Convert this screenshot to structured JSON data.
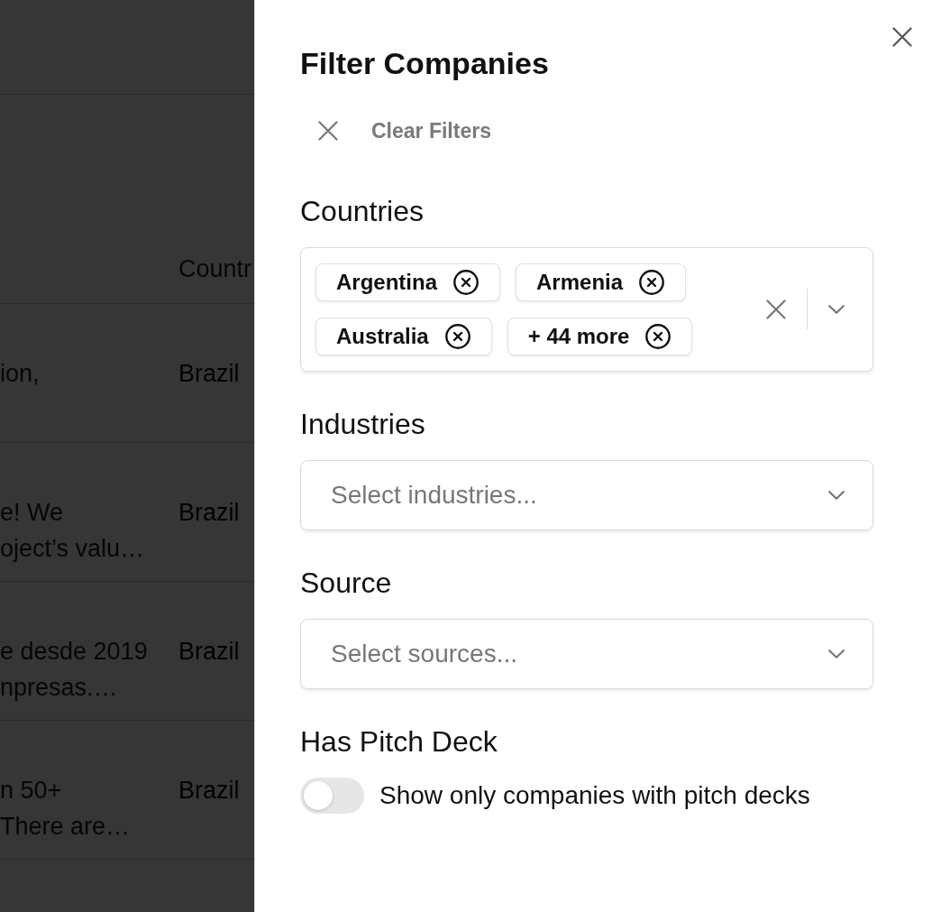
{
  "background_table": {
    "column_2_header": "Countr",
    "rows": [
      {
        "column_1": [
          "ion,"
        ],
        "column_2": "Brazil"
      },
      {
        "column_1": [
          "e! We",
          "oject’s valu…"
        ],
        "column_2": "Brazil"
      },
      {
        "column_1": [
          "e desde 2019",
          "npresas.…"
        ],
        "column_2": "Brazil"
      },
      {
        "column_1": [
          "n 50+",
          "There are…"
        ],
        "column_2": "Brazil"
      }
    ]
  },
  "panel": {
    "title": "Filter Companies",
    "clear_button": "Clear Filters"
  },
  "filters": [
    {
      "kind": "multiselect",
      "label": "Countries",
      "tags": [
        {
          "label": "Argentina"
        },
        {
          "label": "Armenia"
        },
        {
          "label": "Australia"
        },
        {
          "label": "+ 44 more"
        }
      ]
    },
    {
      "kind": "select",
      "label": "Industries",
      "placeholder": "Select industries..."
    },
    {
      "kind": "select",
      "label": "Source",
      "placeholder": "Select sources..."
    },
    {
      "kind": "toggle",
      "label": "Has Pitch Deck",
      "text": "Show only companies with pitch decks",
      "on": false
    }
  ]
}
